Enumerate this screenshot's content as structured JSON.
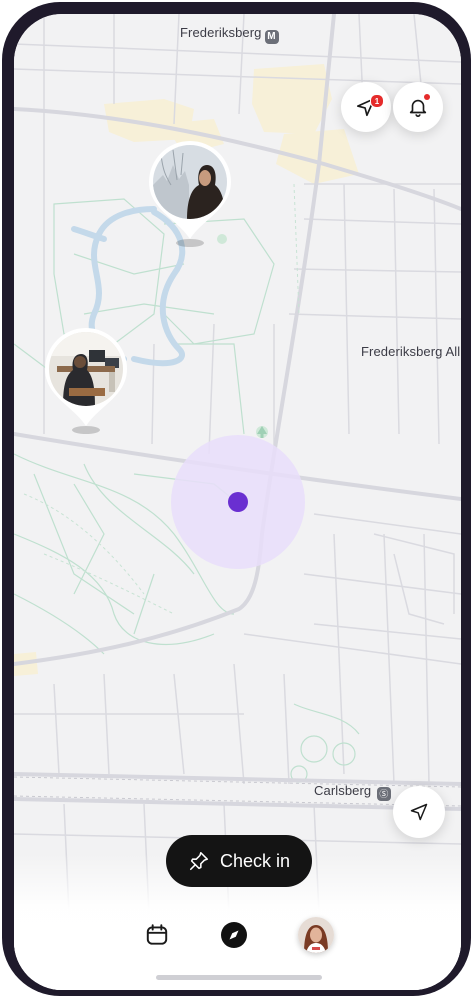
{
  "map": {
    "labels": {
      "frederiksberg_station": "Frederiksberg",
      "frederiksberg_metro": "M",
      "frederiksberg_alle": "Frederiksberg All",
      "carlsberg_station": "Carlsberg",
      "carlsberg_train": "Ⓢ"
    },
    "accent_color": "#6a2fd1",
    "accuracy_color": "#e9defa"
  },
  "header": {
    "explore_badge_count": "1"
  },
  "actions": {
    "checkin_label": "Check in"
  },
  "icons": {
    "explore": "paper-plane-icon",
    "notifications": "bell-icon",
    "recenter": "location-arrow-icon",
    "checkin": "pin-icon",
    "calendar": "calendar-icon",
    "compass": "compass-icon"
  }
}
